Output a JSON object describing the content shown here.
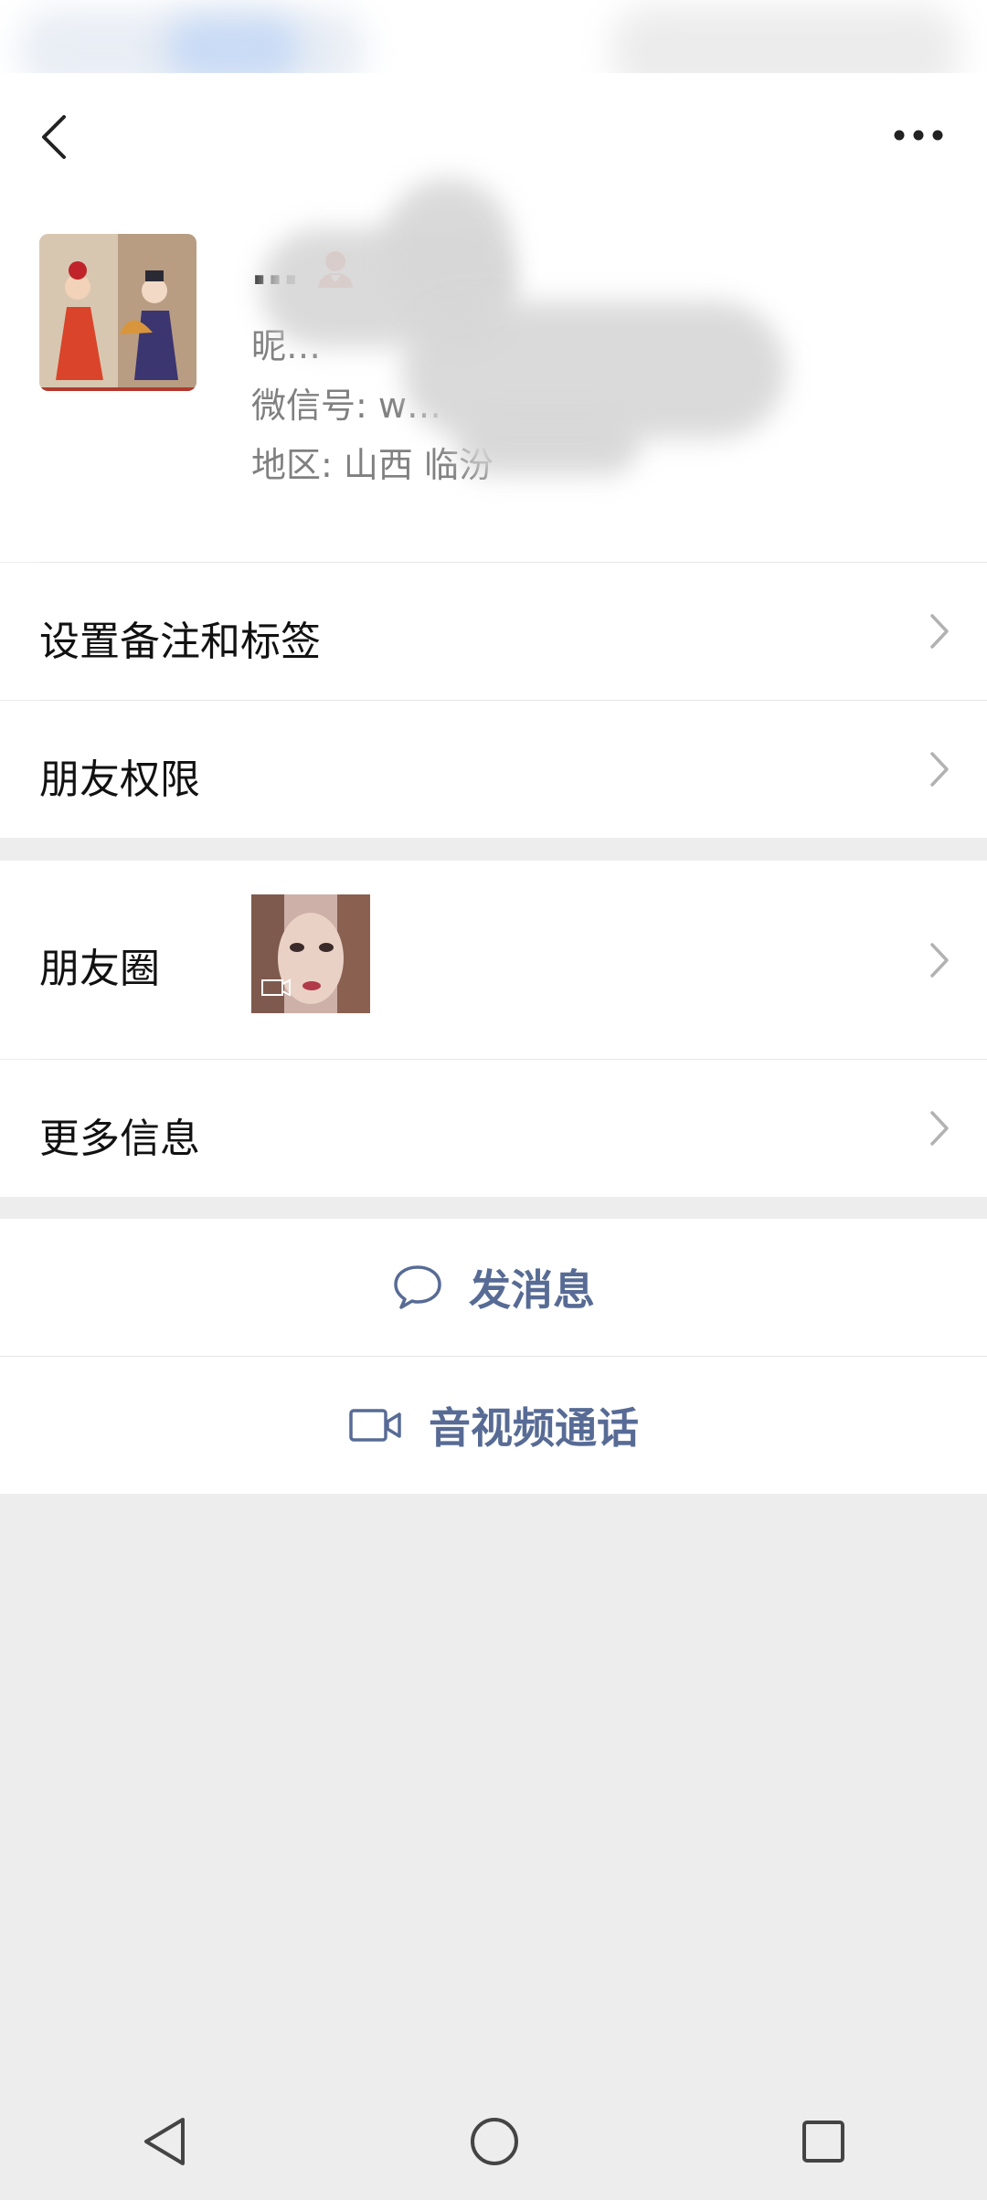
{
  "header": {
    "back_icon": "back-arrow-icon",
    "more_icon": "more-horizontal-icon"
  },
  "profile": {
    "name": "…",
    "nickname": "昵…",
    "wechat_id": "微信号: w…",
    "region": "地区:  山西  临汾",
    "person_icon": "person-icon"
  },
  "menu": {
    "remark_tags": "设置备注和标签",
    "friend_permissions": "朋友权限",
    "moments": "朋友圈",
    "more_info": "更多信息"
  },
  "actions": {
    "send_message": "发消息",
    "av_call": "音视频通话"
  },
  "colors": {
    "accent": "#576b95",
    "background": "#ededed",
    "divider": "#e5e5e5",
    "person_icon": "#f05d40"
  }
}
